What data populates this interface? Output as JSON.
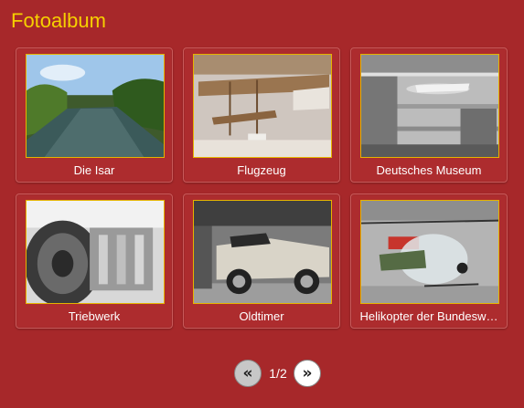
{
  "album": {
    "title": "Fotoalbum"
  },
  "photos": [
    {
      "caption": "Die Isar",
      "image": "river-photo"
    },
    {
      "caption": "Flugzeug",
      "image": "airplane-photo"
    },
    {
      "caption": "Deutsches Museum",
      "image": "museum-hall-photo"
    },
    {
      "caption": "Triebwerk",
      "image": "engine-photo"
    },
    {
      "caption": "Oldtimer",
      "image": "vintage-car-photo"
    },
    {
      "caption": "Helikopter der Bundesw…",
      "image": "helicopter-photo"
    }
  ],
  "pagination": {
    "prev_label": "«",
    "page_info": "1/2",
    "next_label": "»"
  },
  "colors": {
    "background": "#a7282a",
    "title": "#f6d000",
    "thumb_border": "#e6b400"
  }
}
